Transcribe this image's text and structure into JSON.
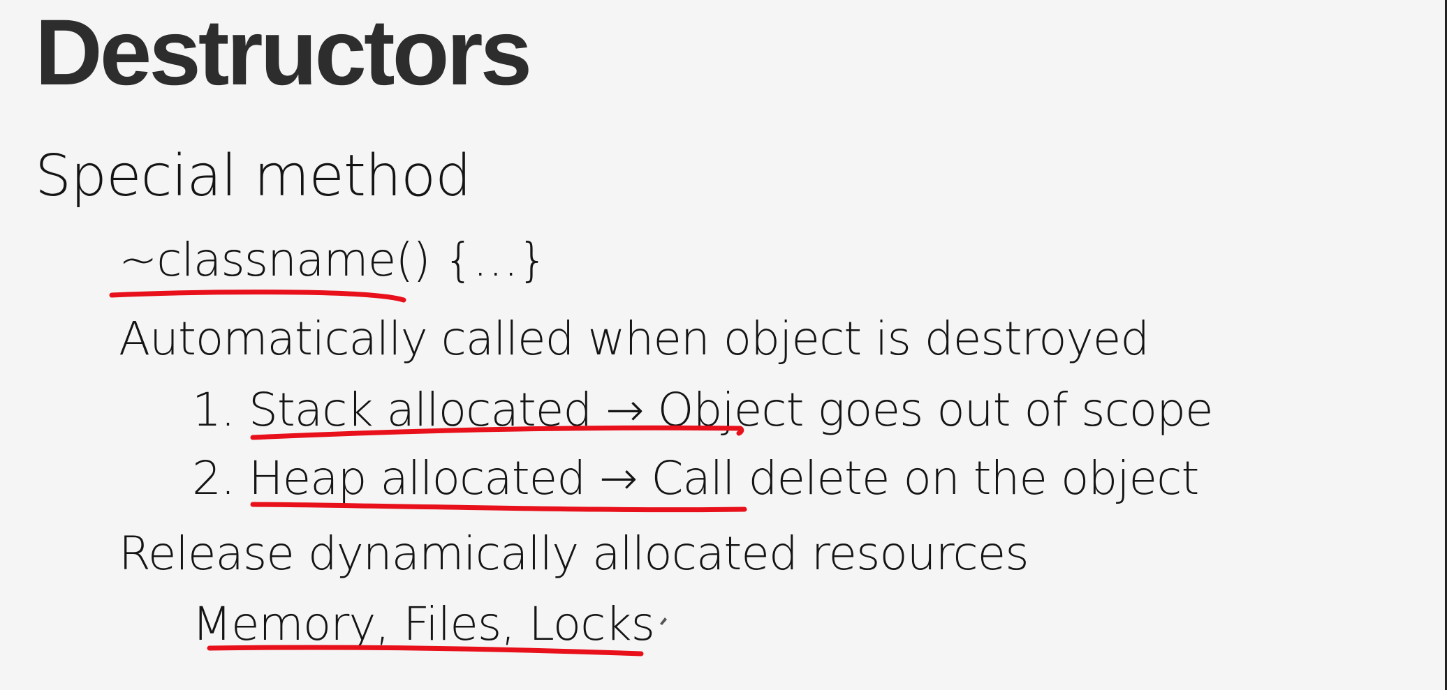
{
  "slide": {
    "title": "Destructors",
    "bullets": [
      {
        "text": "Special method",
        "level": 0
      },
      {
        "text": "~classname() {…}",
        "level": 1
      },
      {
        "text": "Automatically called when object is destroyed",
        "level": 1
      },
      {
        "text": "1. Stack allocated → Object goes out of scope",
        "level": 2
      },
      {
        "text": "2. Heap allocated → Call delete on the object",
        "level": 2
      },
      {
        "text": "Release dynamically allocated resources",
        "level": 1
      },
      {
        "text": "Memory, Files, Locks",
        "level": 2
      }
    ]
  },
  "annotations": {
    "underline_color": "#e8101a",
    "underlined_phrases": [
      "~classname()",
      "Stack allocated → Obj",
      "Heap allocated → Call",
      "Memory, Files, Locks"
    ]
  }
}
